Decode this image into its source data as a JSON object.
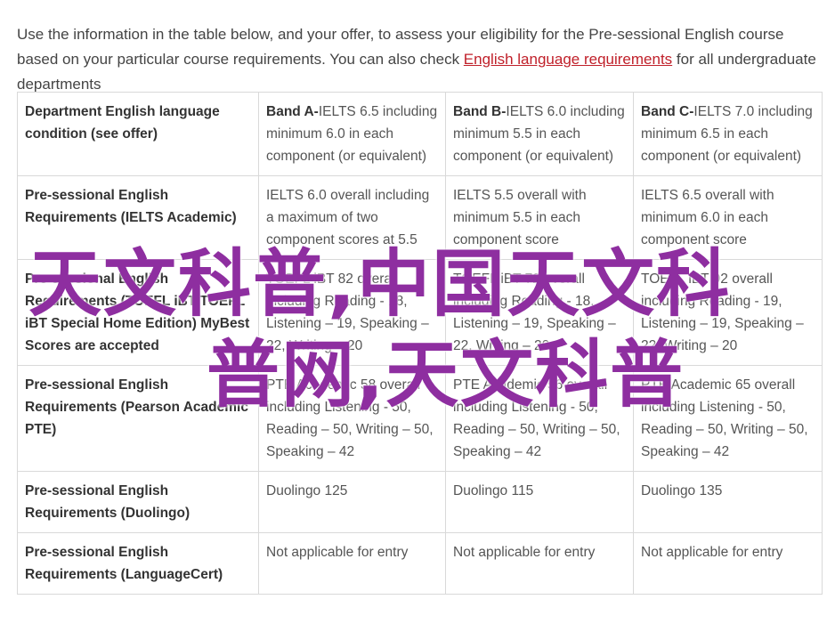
{
  "intro": {
    "text_before": "Use the information in the table below, and your offer, to assess your eligibility for the Pre-sessional English course based on your particular course requirements. You can also check ",
    "link": "English language requirements",
    "text_after": " for all undergraduate departments"
  },
  "table": {
    "header": {
      "label": "Department English language condition (see offer)",
      "bands": [
        {
          "name": "Band A-",
          "detail": "IELTS 6.5 including minimum 6.0 in each component (or equivalent)"
        },
        {
          "name": "Band B-",
          "detail": "IELTS 6.0 including minimum 5.5 in each component (or equivalent)"
        },
        {
          "name": "Band C-",
          "detail": "IELTS 7.0 including minimum 6.5 in each component (or equivalent)"
        }
      ]
    },
    "rows": [
      {
        "label": "Pre-sessional English Requirements (IELTS Academic)",
        "cells": [
          "IELTS 6.0 overall including a maximum of two component scores at 5.5",
          "IELTS 5.5 overall with minimum 5.5 in each component score",
          "IELTS 6.5 overall with minimum 6.0 in each component score"
        ]
      },
      {
        "label": "Pre-sessional English Requirements (TOEFL iBT/TOEFL iBT Special Home Edition) MyBest Scores are accepted",
        "cells": [
          "TOEFL iBT 82 overall including Reading - 18, Listening – 19, Speaking – 22, Writing – 20",
          "TOEFL iBT 72 overall including Reading - 18, Listening – 19, Speaking – 22, Writing – 20",
          "TOEFL iBT 92 overall including Reading - 19, Listening – 19, Speaking – 22, Writing – 20"
        ]
      },
      {
        "label": "Pre-sessional English Requirements (Pearson Academic PTE)",
        "cells": [
          "PTE Academic 58 overall including Listening - 50, Reading – 50, Writing – 50, Speaking – 42",
          "PTE Academic 56 overall including Listening - 50, Reading – 50, Writing – 50, Speaking – 42",
          "PTE Academic 65 overall including Listening - 50, Reading – 50, Writing – 50, Speaking – 42"
        ]
      },
      {
        "label": "Pre-sessional English Requirements (Duolingo)",
        "cells": [
          "Duolingo 125",
          "Duolingo 115",
          "Duolingo 135"
        ]
      },
      {
        "label": "Pre-sessional English Requirements (LanguageCert)",
        "cells": [
          "Not applicable for entry",
          "Not applicable for entry",
          "Not applicable for entry"
        ]
      }
    ]
  },
  "watermark": {
    "line1": "天文科普,中国天文科",
    "line2": "普网,天文科普",
    "color": "#8e2ea0"
  }
}
